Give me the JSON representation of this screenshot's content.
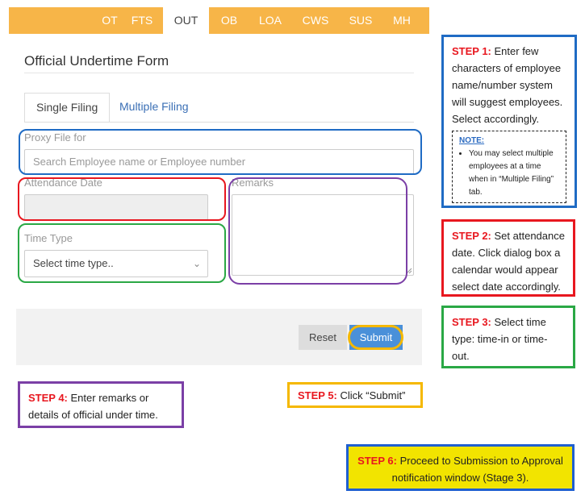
{
  "nav": {
    "tabs": [
      "OT",
      "FTS",
      "OUT",
      "OB",
      "LOA",
      "CWS",
      "SUS",
      "MH"
    ],
    "active": "OUT"
  },
  "form": {
    "title": "Official Undertime Form",
    "tabs": {
      "single": "Single Filing",
      "multiple": "Multiple Filing"
    },
    "proxy_label": "Proxy File for",
    "proxy_placeholder": "Search Employee name or Employee number",
    "date_label": "Attendance Date",
    "remarks_label": "Remarks",
    "time_label": "Time Type",
    "time_value": "Select time type..",
    "reset": "Reset",
    "submit": "Submit"
  },
  "steps": {
    "s1": {
      "label": "STEP 1:",
      "text": "Enter few characters of employee name/number system will suggest employees. Select accordingly."
    },
    "note": {
      "title": "NOTE:",
      "text": "You may select multiple employees at a time when in “Multiple Filing” tab."
    },
    "s2": {
      "label": "STEP 2:",
      "text": "Set attendance date. Click dialog box a calendar would appear select date accordingly."
    },
    "s3": {
      "label": "STEP 3:",
      "text": "Select time type: time-in or time-out."
    },
    "s4": {
      "label": "STEP 4:",
      "text": "Enter remarks or details of official under time."
    },
    "s5": {
      "label": "STEP 5:",
      "text": "Click “Submit”"
    },
    "s6": {
      "label": "STEP 6:",
      "text": "Proceed to Submission to Approval notification window (Stage 3)."
    }
  },
  "colors": {
    "nav_bg": "#f7b548",
    "step1": "#1f6bc4",
    "step2": "#e8171f",
    "step3": "#2aa845",
    "step4": "#7b3fa6",
    "step5": "#f5b800",
    "step6": "#f2e400",
    "step6_border": "#1f5fd1"
  }
}
